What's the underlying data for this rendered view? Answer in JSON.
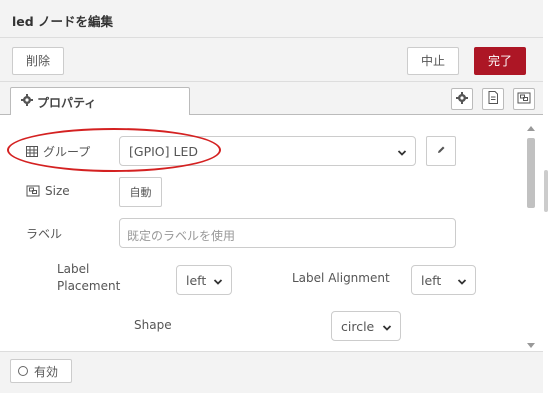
{
  "header": {
    "title": "led ノードを編集"
  },
  "toolbar": {
    "delete_label": "削除",
    "cancel_label": "中止",
    "done_label": "完了"
  },
  "tabs": {
    "properties_label": "プロパティ"
  },
  "form": {
    "group": {
      "label": "グループ",
      "value": "[GPIO] LED"
    },
    "size": {
      "label": "Size",
      "button": "自動"
    },
    "name": {
      "label": "ラベル",
      "placeholder": "既定のラベルを使用"
    },
    "label_placement": {
      "label_line1": "Label",
      "label_line2": "Placement",
      "value": "left"
    },
    "label_alignment": {
      "label": "Label Alignment",
      "value": "left"
    },
    "shape": {
      "label": "Shape",
      "value": "circle"
    }
  },
  "footer": {
    "enabled_label": "有効"
  },
  "colors": {
    "accent": "#AD1625",
    "highlight": "#D42121"
  }
}
